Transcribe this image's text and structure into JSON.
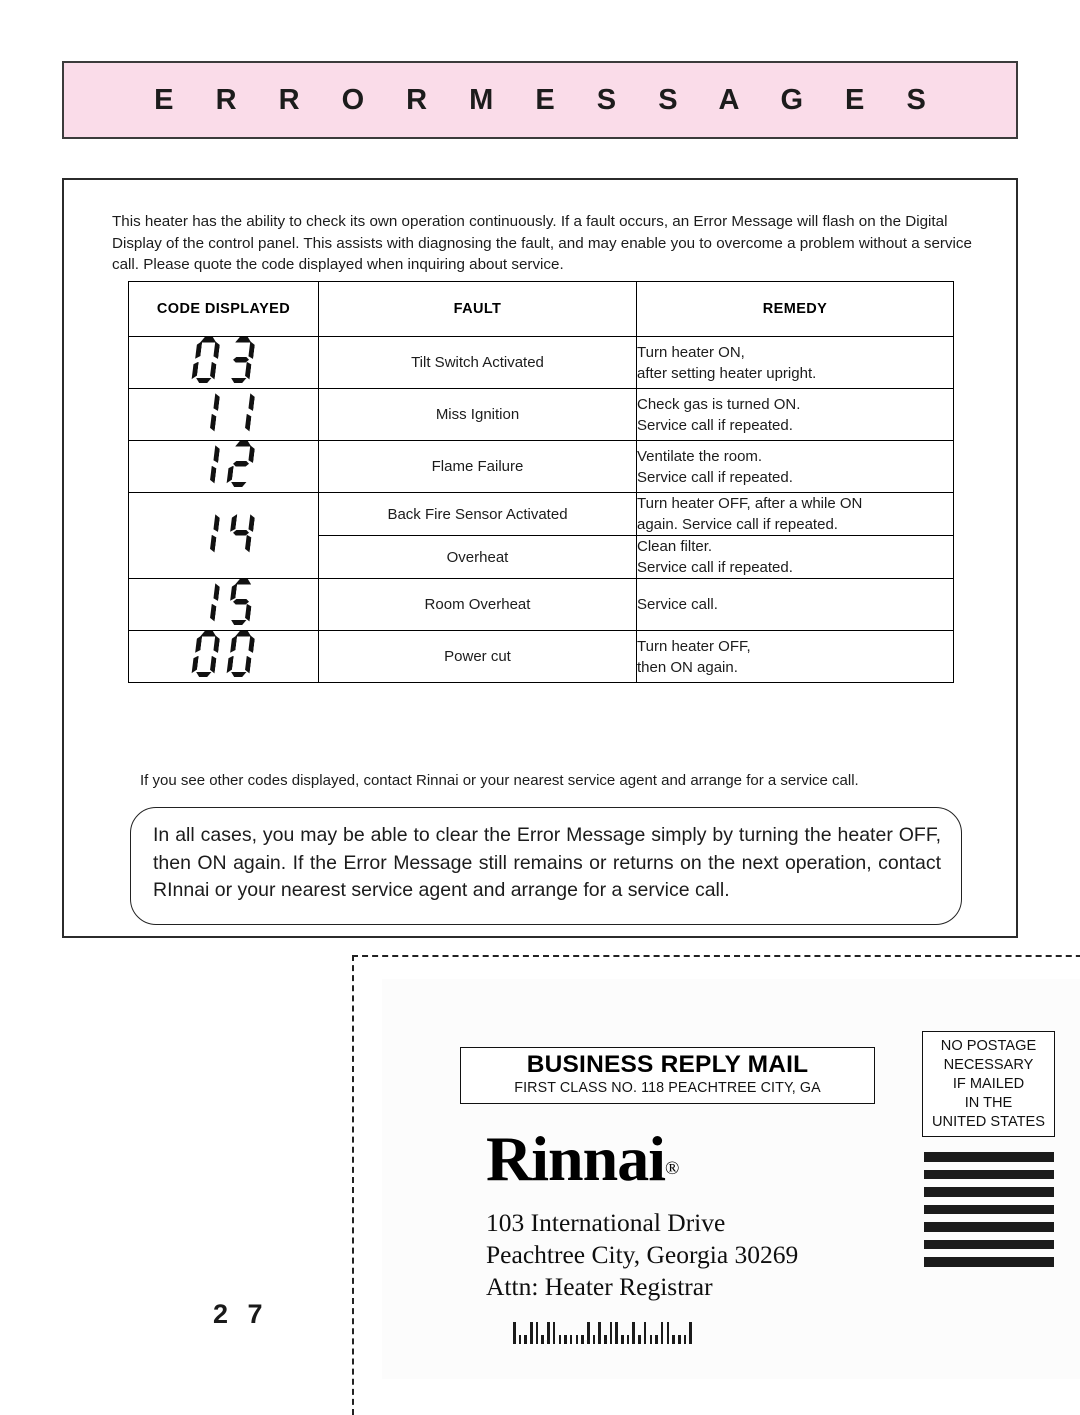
{
  "page": {
    "header_title": "E R R O R   M E S S A G E S",
    "page_number": "2 7"
  },
  "intro": {
    "paragraph": "This heater has the ability to check its own operation continuously.  If a fault occurs, an Error Message will flash on the Digital Display of the control panel.  This assists with diagnosing the fault, and may enable you to overcome a problem without a service call.  Please quote the code displayed when inquiring about service."
  },
  "table": {
    "headers": {
      "code": "CODE DISPLAYED",
      "fault": "FAULT",
      "remedy": "REMEDY"
    },
    "rows": [
      {
        "code": "03",
        "fault": "Tilt Switch Activated",
        "remedy_line1": "Turn heater ON,",
        "remedy_line2": "after setting heater upright."
      },
      {
        "code": "11",
        "fault": "Miss Ignition",
        "remedy_line1": "Check gas is turned ON.",
        "remedy_line2": "Service call if repeated."
      },
      {
        "code": "12",
        "fault": "Flame Failure",
        "remedy_line1": "Ventilate the room.",
        "remedy_line2": "Service call if repeated."
      },
      {
        "code": "14",
        "fault": "Back Fire Sensor Activated",
        "remedy_line1": "Turn heater OFF, after a while ON",
        "remedy_line2": "again. Service call if repeated."
      },
      {
        "code": "",
        "fault": "Overheat",
        "remedy_line1": "Clean filter.",
        "remedy_line2": "Service call if repeated."
      },
      {
        "code": "15",
        "fault": "Room Overheat",
        "remedy_line1": "Service call.",
        "remedy_line2": ""
      },
      {
        "code": "00",
        "fault": "Power cut",
        "remedy_line1": "Turn heater OFF,",
        "remedy_line2": "then ON again."
      }
    ]
  },
  "footnote": {
    "text": "If you see other codes displayed, contact Rinnai or your nearest service agent and arrange for a service call."
  },
  "callout": {
    "text": "In all cases, you may be able to clear the Error Message simply by turning the heater OFF, then ON again.  If the Error Message still remains or returns on the next operation, contact RInnai or your nearest service agent and arrange for a service call."
  },
  "reply_mail": {
    "brm_title": "BUSINESS REPLY MAIL",
    "brm_subtitle": "FIRST CLASS NO. 118 PEACHTREE CITY, GA",
    "logo": "Rinnai",
    "logo_mark": "®",
    "address_line1": "103 International Drive",
    "address_line2": "Peachtree City, Georgia 30269",
    "address_line3": "Attn:  Heater Registrar",
    "postage": {
      "line1": "NO POSTAGE",
      "line2": "NECESSARY",
      "line3": "IF MAILED",
      "line4": "IN THE",
      "line5": "UNITED STATES"
    }
  },
  "colors": {
    "banner_pink": "#fadce9",
    "ink": "#1c1c1c",
    "rule": "#000000"
  }
}
